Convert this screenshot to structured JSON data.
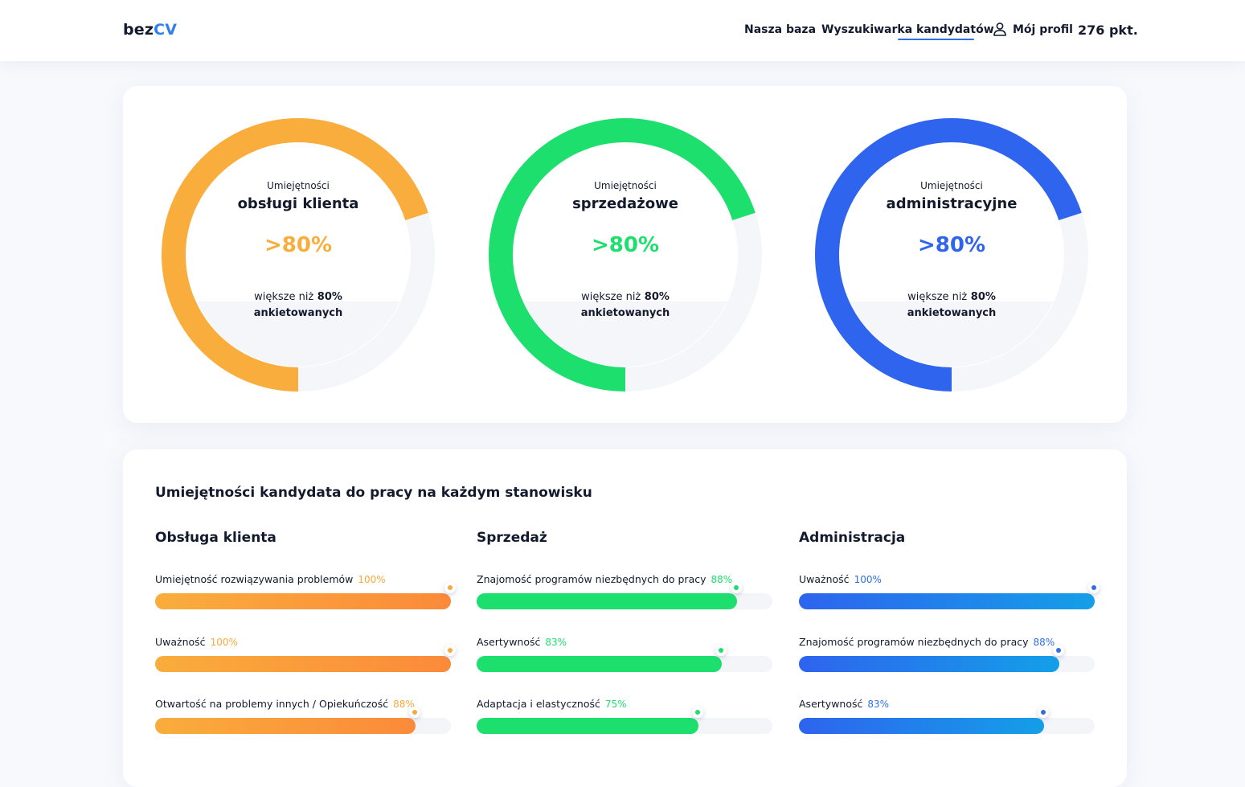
{
  "header": {
    "logo_part1": "bez",
    "logo_part2": "CV",
    "nav": [
      "Nasza baza",
      "Wyszukiwarka kandydatów"
    ],
    "profile_label": "Mój profil",
    "points": "276 pkt."
  },
  "colors": {
    "orange": "#f9ad3c",
    "orange_end": "#fb8a3a",
    "green": "#1ddf6e",
    "blue": "#2e64ee",
    "blue_end": "#149fe8",
    "track": "#f5f6f9",
    "text": "#141a2e",
    "accent": "#2f80ed"
  },
  "donuts": [
    {
      "pre": "Umiejętności",
      "title": "obsługi klienta",
      "value": ">80%",
      "fraction": 0.7,
      "color": "#f9ad3c",
      "sub_line1_light": "większe niż",
      "sub_line1_bold": "80%",
      "sub_line2": "ankietowanych"
    },
    {
      "pre": "Umiejętności",
      "title": "sprzedażowe",
      "value": ">80%",
      "fraction": 0.7,
      "color": "#1ddf6e",
      "sub_line1_light": "większe niż",
      "sub_line1_bold": "80%",
      "sub_line2": "ankietowanych"
    },
    {
      "pre": "Umiejętności",
      "title": "administracyjne",
      "value": ">80%",
      "fraction": 0.7,
      "color": "#2e64ee",
      "sub_line1_light": "większe niż",
      "sub_line1_bold": "80%",
      "sub_line2": "ankietowanych"
    }
  ],
  "skills_section": {
    "title": "Umiejętności kandydata do pracy na każdym stanowisku",
    "columns": [
      {
        "title": "Obsługa klienta",
        "color_start": "#f9ad3c",
        "color_end": "#fb8a3a",
        "dot": "#f9a83c",
        "items": [
          {
            "label": "Umiejętność rozwiązywania problemów",
            "pct_label": "100%",
            "value": 1.0
          },
          {
            "label": "Uważność",
            "pct_label": "100%",
            "value": 1.0
          },
          {
            "label": "Otwartość na problemy innych / Opiekuńczość",
            "pct_label": "88%",
            "value": 0.88
          }
        ]
      },
      {
        "title": "Sprzedaż",
        "color_start": "#1ddf6e",
        "color_end": "#1ddf6e",
        "dot": "#1ddf6e",
        "items": [
          {
            "label": "Znajomość programów niezbędnych do pracy",
            "pct_label": "88%",
            "value": 0.88
          },
          {
            "label": "Asertywność",
            "pct_label": "83%",
            "value": 0.83
          },
          {
            "label": "Adaptacja i elastyczność",
            "pct_label": "75%",
            "value": 0.75
          }
        ]
      },
      {
        "title": "Administracja",
        "color_start": "#2e64ee",
        "color_end": "#149fe8",
        "dot": "#2e6fe6",
        "items": [
          {
            "label": "Uważność",
            "pct_label": "100%",
            "value": 1.0
          },
          {
            "label": "Znajomość programów niezbędnych do pracy",
            "pct_label": "88%",
            "value": 0.88
          },
          {
            "label": "Asertywność",
            "pct_label": "83%",
            "value": 0.83
          }
        ]
      }
    ]
  }
}
